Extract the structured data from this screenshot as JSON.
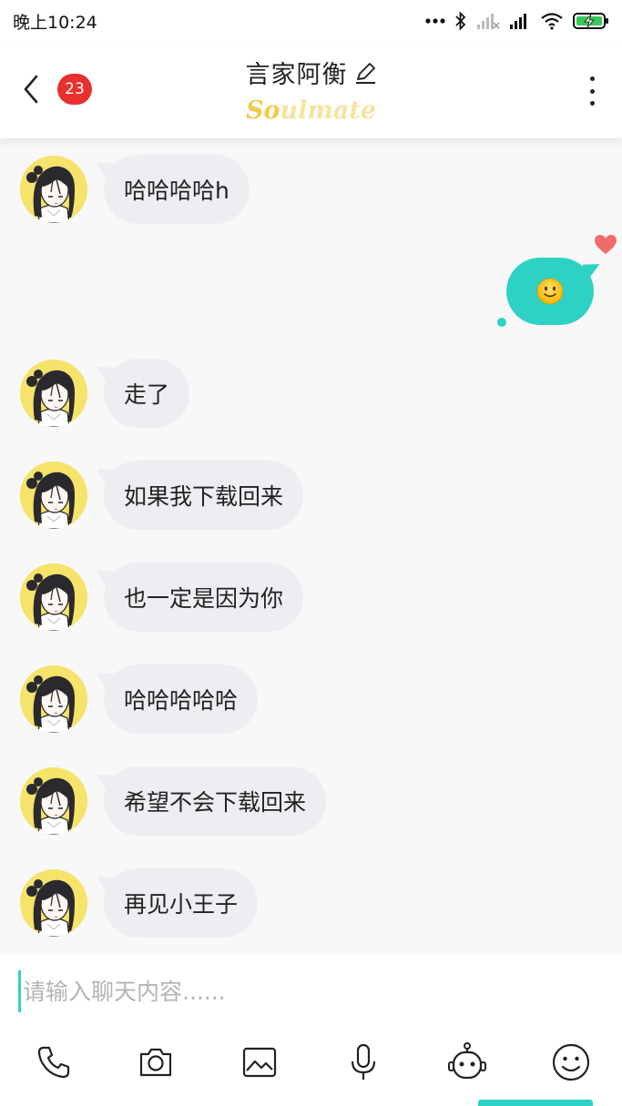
{
  "status_bar": {
    "time": "晚上10:24",
    "icons": [
      "dots-icon",
      "bluetooth-icon",
      "signal-off-icon",
      "signal-icon",
      "wifi-icon",
      "battery-charging-icon"
    ]
  },
  "header": {
    "back_icon": "chevron-left-icon",
    "unread_count": "23",
    "title": "言家阿衡",
    "edit_icon": "pencil-icon",
    "subtitle_part1": "So",
    "subtitle_part2": "ulmate",
    "more_icon": "more-vertical-icon"
  },
  "messages": [
    {
      "from": "them",
      "text": "哈哈哈哈h"
    },
    {
      "from": "me",
      "type": "emoji",
      "emoji": "slightly-smiling-face",
      "liked": true
    },
    {
      "from": "them",
      "text": "走了"
    },
    {
      "from": "them",
      "text": "如果我下载回来"
    },
    {
      "from": "them",
      "text": "也一定是因为你"
    },
    {
      "from": "them",
      "text": "哈哈哈哈哈"
    },
    {
      "from": "them",
      "text": "希望不会下载回来"
    },
    {
      "from": "them",
      "text": "再见小王子"
    }
  ],
  "input": {
    "placeholder": "请输入聊天内容......",
    "value": ""
  },
  "toolbar": [
    "phone-icon",
    "camera-icon",
    "image-icon",
    "microphone-icon",
    "robot-icon",
    "smiley-icon"
  ],
  "colors": {
    "accent": "#2ed2c4",
    "badge": "#e8302e",
    "bubble_incoming": "#eceef1",
    "logo_yellow": "#f2c94c",
    "heart": "#f26b6b"
  }
}
